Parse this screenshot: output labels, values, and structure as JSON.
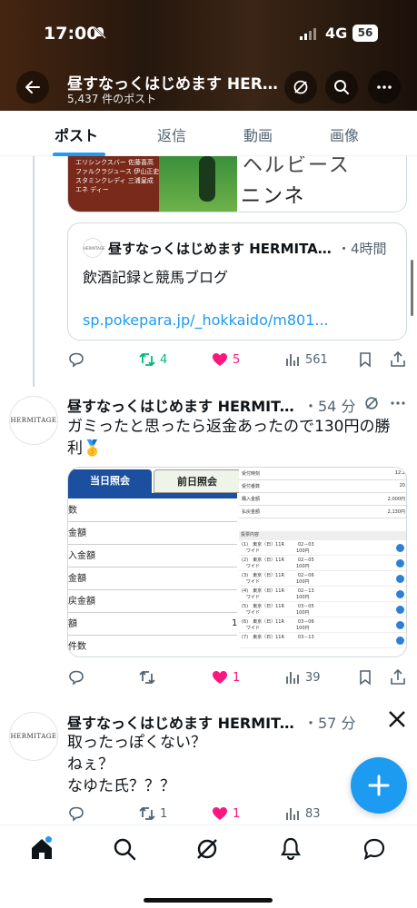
{
  "status_bar": {
    "time": "17:00",
    "network": "4G",
    "battery": "56"
  },
  "header": {
    "title": "昼すなっくはじめます HERMITAGE",
    "subtitle": "5,437 件のポスト"
  },
  "tabs": [
    {
      "label": "ポスト",
      "active": true
    },
    {
      "label": "返信",
      "active": false
    },
    {
      "label": "動画",
      "active": false
    },
    {
      "label": "画像",
      "active": false
    }
  ],
  "card_image": {
    "rows": [
      "エリシンクスバー 佐藤喜高",
      "ファルクラジュース 伊山正史",
      "スタミンクレディ 三浦皇成",
      "エネ ディー"
    ],
    "text_top": "ヘルビース",
    "text_bottom": "ニンネ"
  },
  "quote": {
    "avatar_text": "HERMITAGE",
    "name": "昼すなっくはじめます HERMITAGE",
    "time": "・4時間",
    "text": "飲酒記録と競馬ブログ",
    "link": "sp.pokepara.jp/_hokkaido/m801..."
  },
  "post1_actions": {
    "retweets": "4",
    "likes": "5",
    "views": "561"
  },
  "post2": {
    "avatar_text": "HERMITAGE",
    "name": "昼すなっくはじめます HERMITAGE",
    "time": "・54 分",
    "text": "ガミったと思ったら返金あったので130円の勝利🥇",
    "actions": {
      "retweets": "",
      "likes": "1",
      "views": "39"
    },
    "media_left": {
      "tab_active": "当日照会",
      "tab_inactive": "前日照会",
      "rows": [
        "数",
        "金額",
        "入金額",
        "金額",
        "戻金額",
        "額",
        "件数"
      ],
      "row_value": "1"
    },
    "media_right": {
      "rows": [
        {
          "label": "受付時刻",
          "value": "12:2"
        },
        {
          "label": "受付番数",
          "value": "20"
        },
        {
          "label": "購入金額",
          "value": "2,000円"
        },
        {
          "label": "払戻金額",
          "value": "2,130円"
        }
      ],
      "list_header": "投票内容",
      "entries": [
        {
          "l1": "(1)　東京（日）11R　　　02－03",
          "l2": "　ワイド　　　　　　　　100円"
        },
        {
          "l1": "(2)　東京（日）11R　　　02－05",
          "l2": "　ワイド　　　　　　　　100円"
        },
        {
          "l1": "(3)　東京（日）11R　　　02－06",
          "l2": "　ワイド　　　　　　　　100円"
        },
        {
          "l1": "(4)　東京（日）11R　　　02－13",
          "l2": "　ワイド　　　　　　　　100円"
        },
        {
          "l1": "(5)　東京（日）11R　　　03－05",
          "l2": "　ワイド　　　　　　　　100円"
        },
        {
          "l1": "(6)　東京（日）11R　　　03－06",
          "l2": "　ワイド　　　　　　　　100円"
        },
        {
          "l1": "(7)　東京（日）11R　　　03－13",
          "l2": ""
        }
      ]
    }
  },
  "post3": {
    "avatar_text": "HERMITAGE",
    "name": "昼すなっくはじめます HERMITAGE",
    "time": "・57 分",
    "text_lines": [
      "取ったっぽくない？",
      "ねぇ？",
      "なゆた氏？？？"
    ],
    "actions": {
      "retweets": "1",
      "likes": "1",
      "views": "83"
    }
  },
  "colors": {
    "accent": "#1d9bf0",
    "like": "#f91880",
    "retweet": "#00ba7c",
    "muted": "#536471"
  }
}
